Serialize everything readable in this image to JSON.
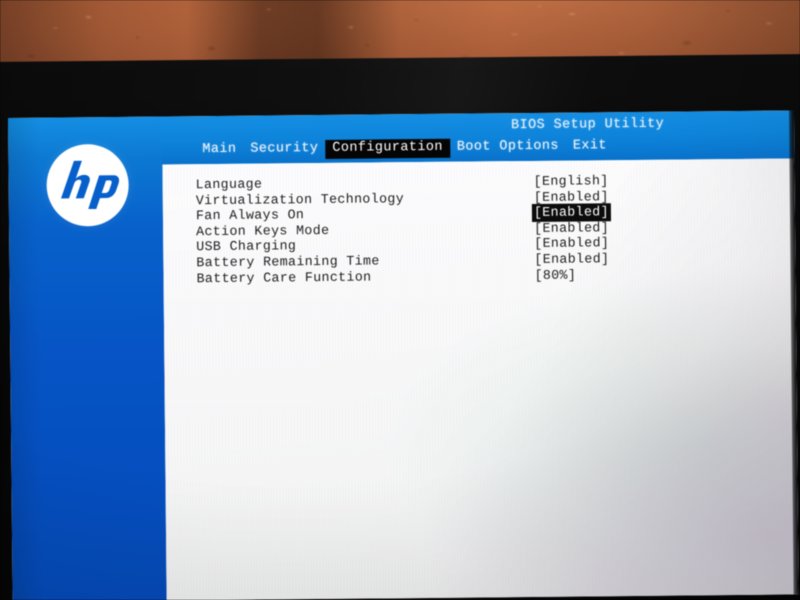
{
  "window": {
    "utility_title": "BIOS Setup Utility",
    "vendor_logo": "hp-logo"
  },
  "tabs": [
    {
      "label": "Main",
      "selected": false
    },
    {
      "label": "Security",
      "selected": false
    },
    {
      "label": "Configuration",
      "selected": true
    },
    {
      "label": "Boot Options",
      "selected": false
    },
    {
      "label": "Exit",
      "selected": false
    }
  ],
  "settings": [
    {
      "label": "Language",
      "value": "[English]",
      "highlighted": false
    },
    {
      "label": "Virtualization Technology",
      "value": "[Enabled]",
      "highlighted": false
    },
    {
      "label": "Fan Always On",
      "value": "[Enabled]",
      "highlighted": true
    },
    {
      "label": "Action Keys Mode",
      "value": "[Enabled]",
      "highlighted": false
    },
    {
      "label": "USB Charging",
      "value": "[Enabled]",
      "highlighted": false
    },
    {
      "label": "Battery Remaining Time",
      "value": "[Enabled]",
      "highlighted": false
    },
    {
      "label": "Battery Care Function",
      "value": "[80%]",
      "highlighted": false
    }
  ],
  "colors": {
    "header_blue": "#1484d5",
    "rail_blue": "#0b56c0",
    "panel_white": "#f6f6f7",
    "selection_black": "#0b0b0b",
    "wall_terracotta": "#a9603c",
    "bezel_black": "#090909"
  }
}
